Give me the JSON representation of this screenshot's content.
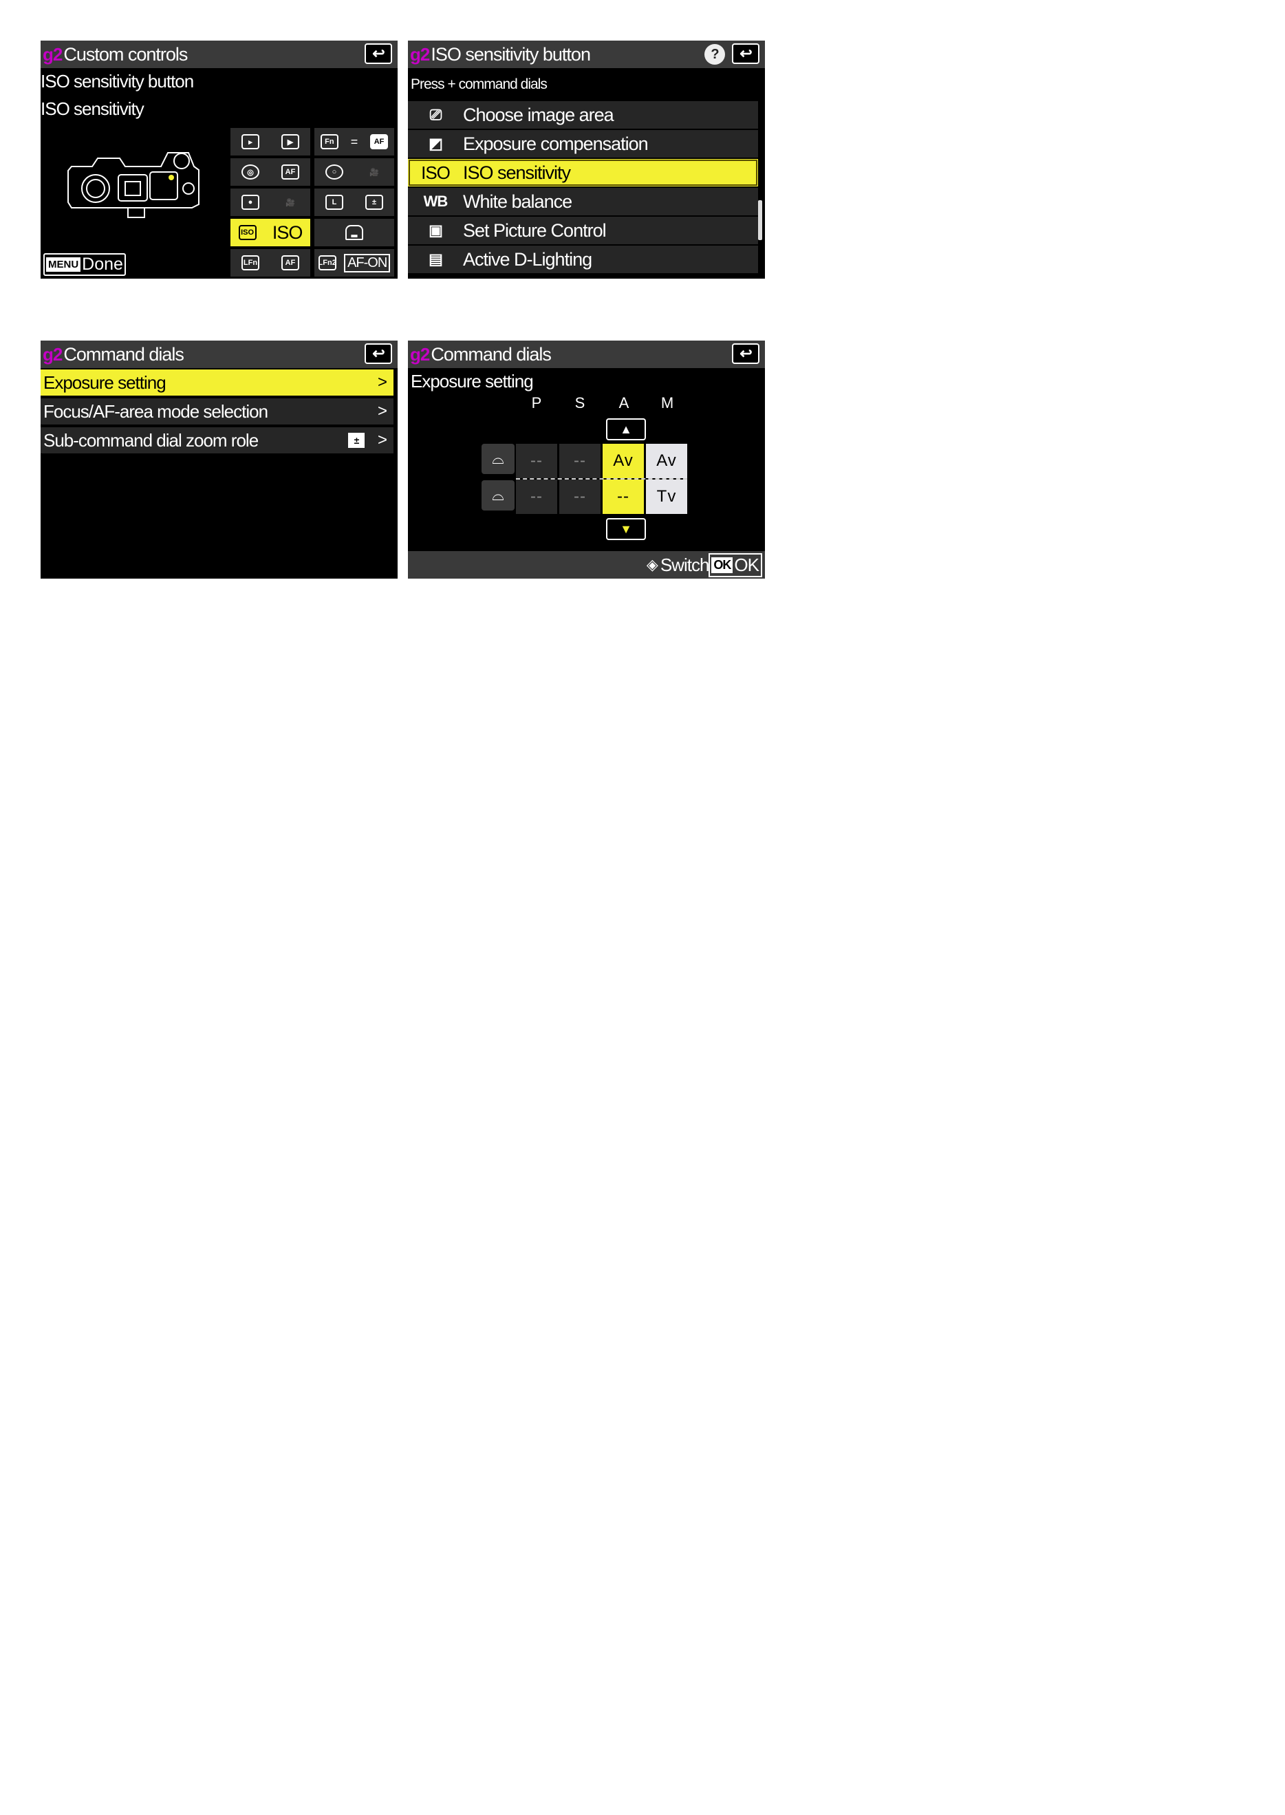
{
  "screen1": {
    "tag": "g2",
    "title": "Custom controls",
    "line1": "ISO sensitivity button",
    "line2": "ISO sensitivity",
    "cells": [
      [
        "",
        ""
      ],
      [
        "",
        "="
      ],
      [
        "",
        ""
      ],
      [
        "",
        ""
      ],
      [
        "",
        ""
      ],
      [
        "",
        ""
      ],
      [
        "",
        "ISO"
      ],
      [
        "",
        ""
      ],
      [
        "",
        ""
      ],
      [
        "",
        "AF-ON"
      ]
    ],
    "menu_key": "MENU",
    "done_label": "Done"
  },
  "screen2": {
    "tag": "g2",
    "title": "ISO sensitivity button",
    "subtitle": "Press + command dials",
    "items": [
      {
        "icon": "",
        "label": "Choose image area"
      },
      {
        "icon": "",
        "label": "Exposure compensation"
      },
      {
        "icon": "ISO",
        "label": "ISO sensitivity"
      },
      {
        "icon": "WB",
        "label": "White balance"
      },
      {
        "icon": "",
        "label": "Set Picture Control"
      },
      {
        "icon": "",
        "label": "Active D-Lighting"
      }
    ],
    "selected_index": 2
  },
  "screen3": {
    "tag": "g2",
    "title": "Command dials",
    "items": [
      {
        "label": "Exposure setting",
        "chevron": ">"
      },
      {
        "label": "Focus/AF-area mode selection",
        "chevron": ">"
      },
      {
        "label": "Sub-command dial zoom role",
        "chevron": ">"
      }
    ],
    "selected_index": 0
  },
  "screen4": {
    "tag": "g2",
    "title": "Command dials",
    "subtitle": "Exposure setting",
    "columns": [
      "P",
      "S",
      "A",
      "M"
    ],
    "main_row": [
      "--",
      "--",
      "Av",
      "Av"
    ],
    "sub_row": [
      "--",
      "--",
      "--",
      "Tv"
    ],
    "selected_column": "A",
    "footer_switch": "Switch",
    "ok_key": "OK",
    "ok_label": "OK"
  },
  "colors": {
    "highlight": "#f3f032",
    "tag": "#c400c4",
    "titlebar": "#3a3a3a",
    "row": "#262626"
  }
}
